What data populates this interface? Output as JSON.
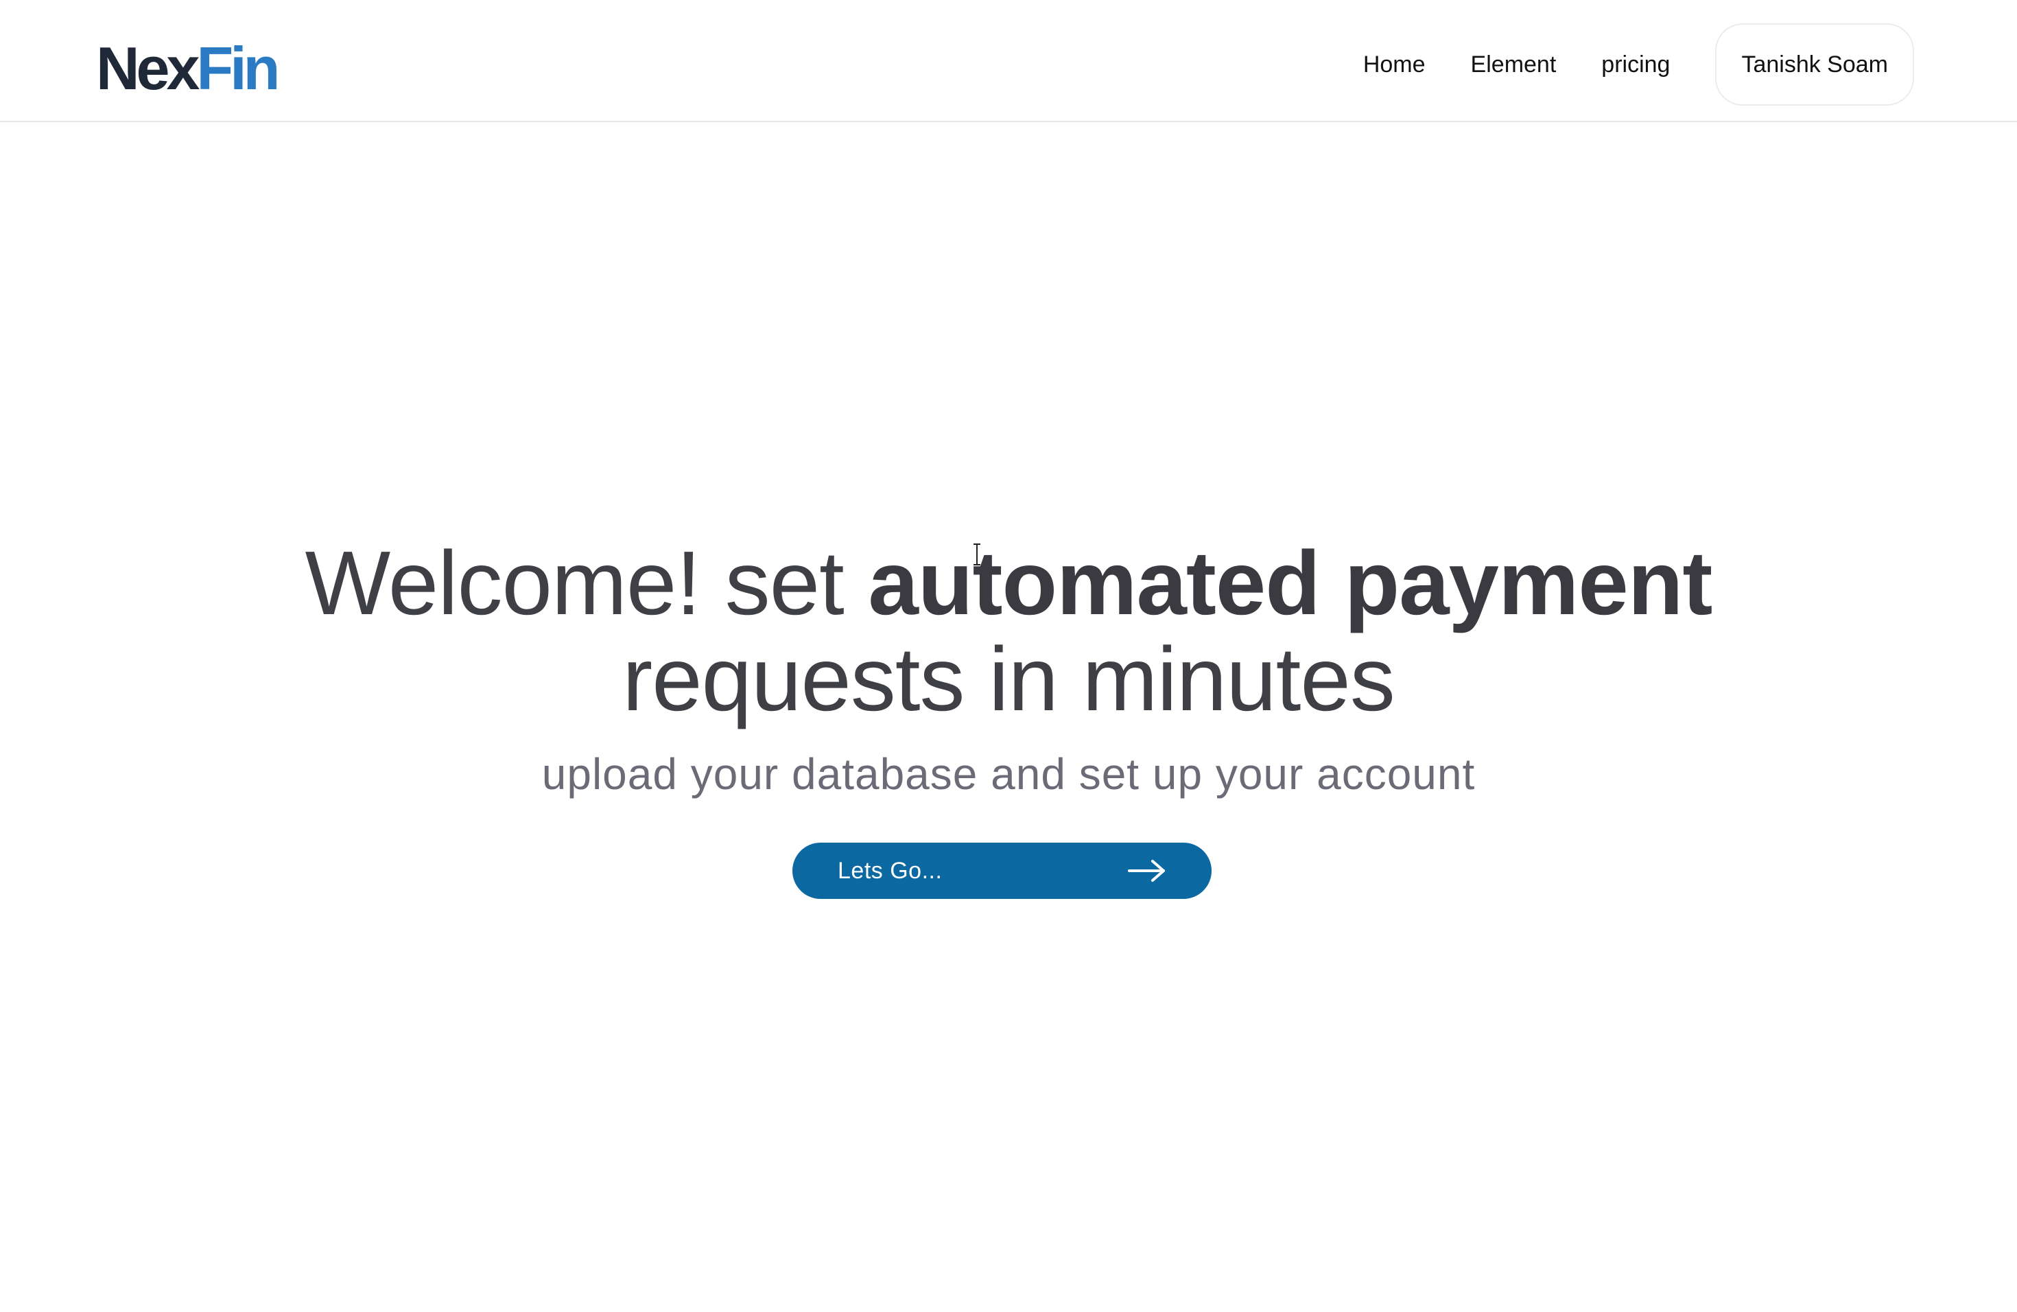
{
  "header": {
    "logo": {
      "part1": "Nex",
      "part2": "Fin"
    },
    "nav": [
      {
        "label": "Home"
      },
      {
        "label": "Element"
      },
      {
        "label": "pricing"
      }
    ],
    "user_name": "Tanishk Soam"
  },
  "hero": {
    "title_regular": "Welcome! set ",
    "title_bold": "automated payment",
    "title_line2": "requests in minutes",
    "subtitle": "upload your database and set up your account",
    "cta_label": "Lets Go...",
    "cta_icon": "arrow-right-icon"
  },
  "colors": {
    "logo_dark": "#1f2937",
    "logo_accent": "#2b7bc4",
    "cta_background": "#0b68a1",
    "title_text": "#3f3f46",
    "subtitle_text": "#6b6b78"
  }
}
